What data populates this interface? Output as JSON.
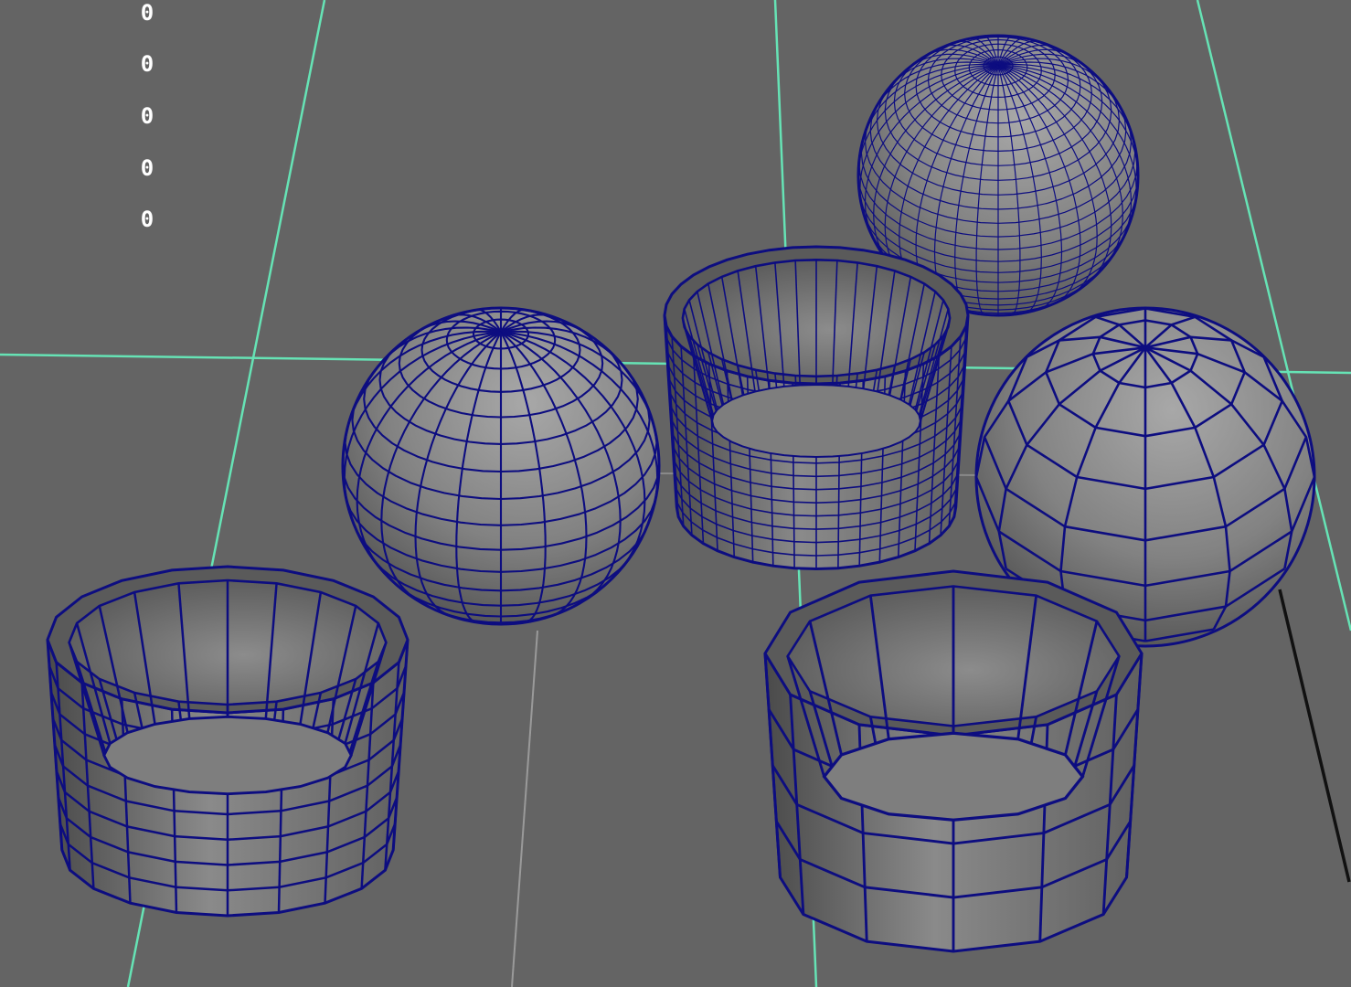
{
  "viewport": {
    "background": "#646464",
    "grid_color": "#66e3b5",
    "wire_color": "#0d0d80",
    "shade_light": "#9a9a9a",
    "shade_dark": "#3f3f3f"
  },
  "hud": {
    "values": [
      "0",
      "0",
      "0",
      "0",
      "0"
    ]
  },
  "objects": [
    {
      "name": "sphere-medium",
      "kind": "polygon-sphere"
    },
    {
      "name": "sphere-dense",
      "kind": "polygon-sphere"
    },
    {
      "name": "sphere-low",
      "kind": "polygon-sphere"
    },
    {
      "name": "bowl-medium",
      "kind": "polygon-bowl"
    },
    {
      "name": "bowl-dense",
      "kind": "polygon-bowl"
    },
    {
      "name": "bowl-low",
      "kind": "polygon-bowl"
    }
  ]
}
